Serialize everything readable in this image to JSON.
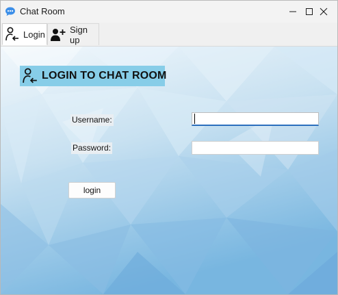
{
  "window": {
    "title": "Chat Room",
    "app_icon": "chat-bubble-icon",
    "controls": {
      "minimize": "minimize-icon",
      "maximize": "maximize-icon",
      "close": "close-icon"
    }
  },
  "tabs": [
    {
      "label": "Login",
      "icon": "user-login-icon",
      "active": true
    },
    {
      "label": "Sign up",
      "icon": "user-add-icon",
      "active": false
    }
  ],
  "login_form": {
    "heading": "LOGIN TO CHAT ROOM",
    "heading_icon": "user-login-icon",
    "heading_bg": "#87cde8",
    "username_label": "Username:",
    "username_value": "",
    "password_label": "Password:",
    "password_value": "",
    "submit_label": "login"
  },
  "colors": {
    "background_light": "#e6f2fa",
    "background_dark": "#6aaedd",
    "focus_underline": "#2a6ebd"
  }
}
